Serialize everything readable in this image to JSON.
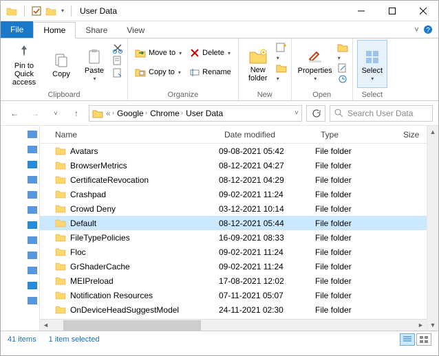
{
  "title": "User Data",
  "menubar": {
    "file": "File",
    "tabs": [
      "Home",
      "Share",
      "View"
    ],
    "active": "Home"
  },
  "ribbon": {
    "clipboard": {
      "label": "Clipboard",
      "pin": "Pin to Quick\naccess",
      "copy": "Copy",
      "paste": "Paste"
    },
    "organize": {
      "label": "Organize",
      "moveto": "Move to",
      "copyto": "Copy to",
      "delete": "Delete",
      "rename": "Rename"
    },
    "new": {
      "label": "New",
      "newfolder": "New\nfolder"
    },
    "open": {
      "label": "Open",
      "properties": "Properties"
    },
    "select": {
      "label": "Select",
      "select": "Select"
    }
  },
  "breadcrumbs": [
    "Google",
    "Chrome",
    "User Data"
  ],
  "search_placeholder": "Search User Data",
  "columns": {
    "name": "Name",
    "date": "Date modified",
    "type": "Type",
    "size": "Size"
  },
  "files": [
    {
      "name": "Avatars",
      "date": "09-08-2021 05:42",
      "type": "File folder"
    },
    {
      "name": "BrowserMetrics",
      "date": "08-12-2021 04:27",
      "type": "File folder"
    },
    {
      "name": "CertificateRevocation",
      "date": "08-12-2021 04:29",
      "type": "File folder"
    },
    {
      "name": "Crashpad",
      "date": "09-02-2021 11:24",
      "type": "File folder"
    },
    {
      "name": "Crowd Deny",
      "date": "03-12-2021 10:14",
      "type": "File folder"
    },
    {
      "name": "Default",
      "date": "08-12-2021 05:44",
      "type": "File folder",
      "selected": true
    },
    {
      "name": "FileTypePolicies",
      "date": "16-09-2021 08:33",
      "type": "File folder"
    },
    {
      "name": "Floc",
      "date": "09-02-2021 11:24",
      "type": "File folder"
    },
    {
      "name": "GrShaderCache",
      "date": "09-02-2021 11:24",
      "type": "File folder"
    },
    {
      "name": "MEIPreload",
      "date": "17-08-2021 12:02",
      "type": "File folder"
    },
    {
      "name": "Notification Resources",
      "date": "07-11-2021 05:07",
      "type": "File folder"
    },
    {
      "name": "OnDeviceHeadSuggestModel",
      "date": "24-11-2021 02:30",
      "type": "File folder"
    }
  ],
  "status": {
    "count": "41 items",
    "selected": "1 item selected"
  },
  "navpane_colors": [
    "#3b84d9",
    "#3b84d9",
    "#0078d4",
    "#3b84d9",
    "#3b84d9",
    "#3b84d9",
    "#0078d4",
    "#3b84d9",
    "#3b84d9",
    "#3b84d9",
    "#0078d4",
    "#3b84d9"
  ]
}
